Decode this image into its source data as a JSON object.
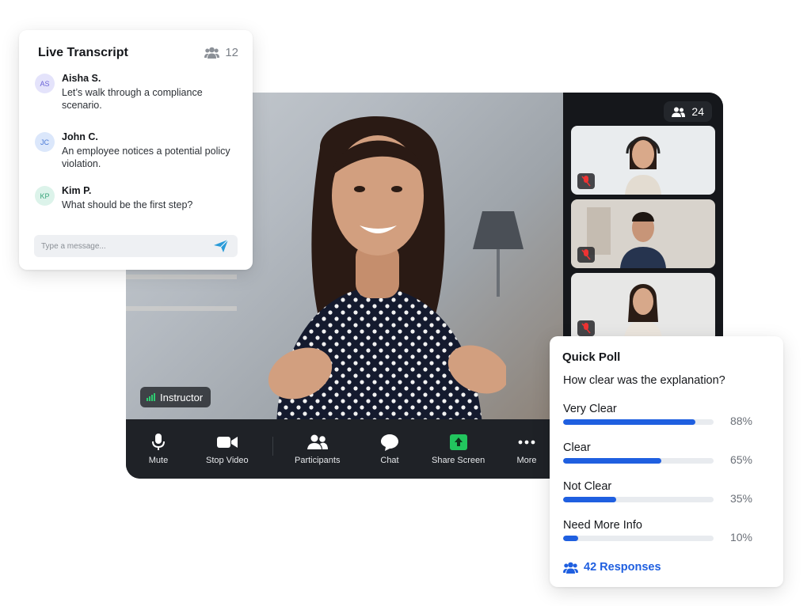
{
  "transcript": {
    "title": "Live Transcript",
    "participant_count": "12",
    "messages": [
      {
        "initials": "AS",
        "name": "Aisha S.",
        "text": "Let’s walk through a compliance scenario.",
        "avatar_bg": "#e4e3fb",
        "avatar_fg": "#6b63d6"
      },
      {
        "initials": "JC",
        "name": "John C.",
        "text": "An employee notices a potential policy violation.",
        "avatar_bg": "#dbe7fb",
        "avatar_fg": "#4b7ad6"
      },
      {
        "initials": "KP",
        "name": "Kim P.",
        "text": "What should be the first step?",
        "avatar_bg": "#dcf3ea",
        "avatar_fg": "#3aa57c"
      }
    ],
    "input_placeholder": "Type a message..."
  },
  "video": {
    "speaker_label": "Instructor",
    "participant_count": "24",
    "toolbar": [
      {
        "label": "Mute",
        "icon": "microphone-icon"
      },
      {
        "label": "Stop Video",
        "icon": "video-camera-icon"
      },
      {
        "label": "Participants",
        "icon": "participants-icon"
      },
      {
        "label": "Chat",
        "icon": "chat-bubble-icon"
      },
      {
        "label": "Share Screen",
        "icon": "share-screen-icon"
      },
      {
        "label": "More",
        "icon": "more-dots-icon"
      }
    ],
    "share_color": "#22c55e"
  },
  "poll": {
    "title": "Quick Poll",
    "question": "How clear was the explanation?",
    "options": [
      {
        "label": "Very Clear",
        "percent_text": "88%",
        "value": 88
      },
      {
        "label": "Clear",
        "percent_text": "65%",
        "value": 65
      },
      {
        "label": "Not Clear",
        "percent_text": "35%",
        "value": 35
      },
      {
        "label": "Need More Info",
        "percent_text": "10%",
        "value": 10
      }
    ],
    "responses": "42 Responses",
    "accent": "#1f5fe0"
  }
}
